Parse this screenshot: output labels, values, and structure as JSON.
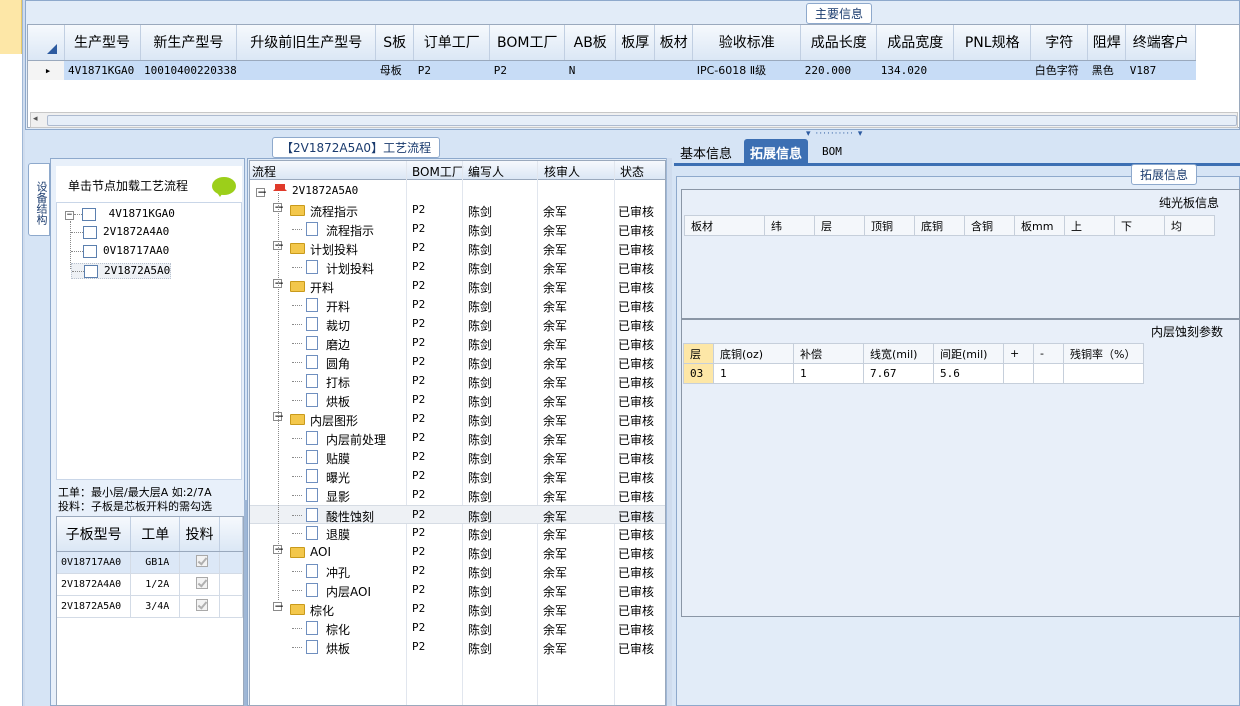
{
  "main_info": {
    "title": "主要信息",
    "columns": [
      "生产型号",
      "新生产型号",
      "升级前旧生产型号",
      "S板",
      "订单工厂",
      "BOM工厂",
      "AB板",
      "板厚",
      "板材",
      "验收标准",
      "成品长度",
      "成品宽度",
      "PNL规格",
      "字符",
      "阻焊",
      "终端客户"
    ],
    "row": [
      "4V1871KGA0",
      "10010400220338",
      "",
      "母板",
      "P2",
      "P2",
      "N",
      "",
      "",
      "IPC-6018 Ⅱ级",
      "220.000",
      "134.020",
      "",
      "白色字符",
      "黑色",
      "V187"
    ]
  },
  "left": {
    "vertical_tab": "设备结构",
    "hint": "单击节点加载工艺流程",
    "tree": {
      "root": "4V1871KGA0",
      "children": [
        "2V1872A4A0",
        "0V18717AA0",
        "2V1872A5A0"
      ]
    },
    "note_line1": "工单：最小层/最大层A 如:2/7A",
    "note_line2": "投料：子板是芯板开料的需勾选",
    "sub_grid": {
      "headers": [
        "子板型号",
        "工单",
        "投料"
      ],
      "rows": [
        {
          "model": "0V18717AA0",
          "order": "GB1A"
        },
        {
          "model": "2V1872A4A0",
          "order": "1/2A"
        },
        {
          "model": "2V1872A5A0",
          "order": "3/4A"
        }
      ]
    }
  },
  "flow": {
    "title": "【2V1872A5A0】工艺流程",
    "headers": [
      "流程",
      "BOM工厂",
      "编写人",
      "核审人",
      "状态"
    ],
    "root": "2V1872A5A0",
    "rows": [
      {
        "name": "流程指示",
        "level": 1,
        "type": "folder",
        "bom": "P2",
        "author": "陈剑",
        "reviewer": "余军",
        "status": "已审核"
      },
      {
        "name": "流程指示",
        "level": 2,
        "type": "page",
        "bom": "P2",
        "author": "陈剑",
        "reviewer": "余军",
        "status": "已审核"
      },
      {
        "name": "计划投料",
        "level": 1,
        "type": "folder",
        "bom": "P2",
        "author": "陈剑",
        "reviewer": "余军",
        "status": "已审核"
      },
      {
        "name": "计划投料",
        "level": 2,
        "type": "page",
        "bom": "P2",
        "author": "陈剑",
        "reviewer": "余军",
        "status": "已审核"
      },
      {
        "name": "开料",
        "level": 1,
        "type": "folder",
        "bom": "P2",
        "author": "陈剑",
        "reviewer": "余军",
        "status": "已审核"
      },
      {
        "name": "开料",
        "level": 2,
        "type": "page",
        "bom": "P2",
        "author": "陈剑",
        "reviewer": "余军",
        "status": "已审核"
      },
      {
        "name": "裁切",
        "level": 2,
        "type": "page",
        "bom": "P2",
        "author": "陈剑",
        "reviewer": "余军",
        "status": "已审核"
      },
      {
        "name": "磨边",
        "level": 2,
        "type": "page",
        "bom": "P2",
        "author": "陈剑",
        "reviewer": "余军",
        "status": "已审核"
      },
      {
        "name": "圆角",
        "level": 2,
        "type": "page",
        "bom": "P2",
        "author": "陈剑",
        "reviewer": "余军",
        "status": "已审核"
      },
      {
        "name": "打标",
        "level": 2,
        "type": "page",
        "bom": "P2",
        "author": "陈剑",
        "reviewer": "余军",
        "status": "已审核"
      },
      {
        "name": "烘板",
        "level": 2,
        "type": "page",
        "bom": "P2",
        "author": "陈剑",
        "reviewer": "余军",
        "status": "已审核"
      },
      {
        "name": "内层图形",
        "level": 1,
        "type": "folder",
        "bom": "P2",
        "author": "陈剑",
        "reviewer": "余军",
        "status": "已审核"
      },
      {
        "name": "内层前处理",
        "level": 2,
        "type": "page",
        "bom": "P2",
        "author": "陈剑",
        "reviewer": "余军",
        "status": "已审核"
      },
      {
        "name": "贴膜",
        "level": 2,
        "type": "page",
        "bom": "P2",
        "author": "陈剑",
        "reviewer": "余军",
        "status": "已审核"
      },
      {
        "name": "曝光",
        "level": 2,
        "type": "page",
        "bom": "P2",
        "author": "陈剑",
        "reviewer": "余军",
        "status": "已审核"
      },
      {
        "name": "显影",
        "level": 2,
        "type": "page",
        "bom": "P2",
        "author": "陈剑",
        "reviewer": "余军",
        "status": "已审核"
      },
      {
        "name": "酸性蚀刻",
        "level": 2,
        "type": "page",
        "bom": "P2",
        "author": "陈剑",
        "reviewer": "余军",
        "status": "已审核",
        "selected": true
      },
      {
        "name": "退膜",
        "level": 2,
        "type": "page",
        "bom": "P2",
        "author": "陈剑",
        "reviewer": "余军",
        "status": "已审核"
      },
      {
        "name": "AOI",
        "level": 1,
        "type": "folder",
        "bom": "P2",
        "author": "陈剑",
        "reviewer": "余军",
        "status": "已审核"
      },
      {
        "name": "冲孔",
        "level": 2,
        "type": "page",
        "bom": "P2",
        "author": "陈剑",
        "reviewer": "余军",
        "status": "已审核"
      },
      {
        "name": "内层AOI",
        "level": 2,
        "type": "page",
        "bom": "P2",
        "author": "陈剑",
        "reviewer": "余军",
        "status": "已审核"
      },
      {
        "name": "棕化",
        "level": 1,
        "type": "folder",
        "bom": "P2",
        "author": "陈剑",
        "reviewer": "余军",
        "status": "已审核"
      },
      {
        "name": "棕化",
        "level": 2,
        "type": "page",
        "bom": "P2",
        "author": "陈剑",
        "reviewer": "余军",
        "status": "已审核"
      },
      {
        "name": "烘板",
        "level": 2,
        "type": "page",
        "bom": "P2",
        "author": "陈剑",
        "reviewer": "余军",
        "status": "已审核"
      }
    ]
  },
  "right": {
    "tabs": [
      "基本信息",
      "拓展信息",
      "BOM"
    ],
    "active_tab": "拓展信息",
    "panel_title": "拓展信息",
    "pure_board": {
      "title": "纯光板信息",
      "headers": [
        "板材",
        "纬",
        "层",
        "顶铜",
        "底铜",
        "含铜",
        "板mm",
        "上",
        "下",
        "均"
      ]
    },
    "etch": {
      "title": "内层蚀刻参数",
      "headers": [
        "层",
        "底铜(oz)",
        "补偿",
        "线宽(mil)",
        "间距(mil)",
        "+",
        "-",
        "残铜率（%）"
      ],
      "row": [
        "03",
        "1",
        "1",
        "7.67",
        "5.6",
        "",
        "",
        ""
      ]
    }
  }
}
